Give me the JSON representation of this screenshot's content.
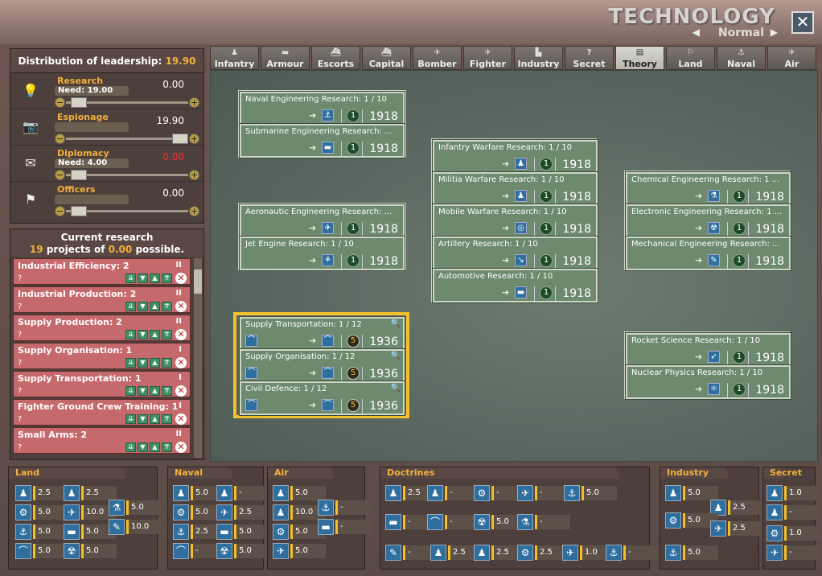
{
  "window": {
    "title": "TECHNOLOGY",
    "mode": "Normal",
    "close": "✕"
  },
  "leadership": {
    "label": "Distribution of leadership:",
    "value": "19.90",
    "rows": [
      {
        "name": "Research",
        "need": "Need: 19.00",
        "value": "0.00",
        "icon": "lightbulb-icon"
      },
      {
        "name": "Espionage",
        "need": "",
        "value": "19.90",
        "icon": "camera-icon"
      },
      {
        "name": "Diplomacy",
        "need": "Need: 4.00",
        "value": "0.00",
        "icon": "envelope-icon"
      },
      {
        "name": "Officers",
        "need": "",
        "value": "0.00",
        "icon": "flag-icon"
      }
    ]
  },
  "current": {
    "title": "Current research",
    "count": "19",
    "mid": "projects of",
    "amt": "0.00",
    "tail": "possible.",
    "items": [
      {
        "name": "Industrial Efficiency: 2",
        "q": "?",
        "pri": "II"
      },
      {
        "name": "Industrial Production: 2",
        "q": "?",
        "pri": "II"
      },
      {
        "name": "Supply Production: 2",
        "q": "?",
        "pri": "II"
      },
      {
        "name": "Supply Organisation: 1",
        "q": "?",
        "pri": "I"
      },
      {
        "name": "Supply Transportation: 1",
        "q": "?",
        "pri": "I"
      },
      {
        "name": "Fighter Ground Crew Training: 1",
        "q": "?",
        "pri": "I"
      },
      {
        "name": "Small Arms: 2",
        "q": "?",
        "pri": "II"
      }
    ]
  },
  "tabs": [
    "Infantry",
    "Armour",
    "Escorts",
    "Capital",
    "Bomber",
    "Fighter",
    "Industry",
    "Secret",
    "Theory",
    "Land",
    "Naval",
    "Air"
  ],
  "active_tab": "Theory",
  "cards": [
    {
      "name": "Naval Engineering Research: 1 / 10",
      "cnt": "1",
      "yr": "1918"
    },
    {
      "name": "Submarine Engineering Research:  ...",
      "cnt": "1",
      "yr": "1918"
    },
    {
      "name": "Aeronautic Engineering Research:  ...",
      "cnt": "1",
      "yr": "1918"
    },
    {
      "name": "Jet Engine Research: 1 / 10",
      "cnt": "1",
      "yr": "1918"
    },
    {
      "name": "Supply Transportation: 1 / 12",
      "cnt": "5",
      "yr": "1936"
    },
    {
      "name": "Supply Organisation: 1 / 12",
      "cnt": "5",
      "yr": "1936"
    },
    {
      "name": "Civil Defence: 1 / 12",
      "cnt": "5",
      "yr": "1936"
    },
    {
      "name": "Infantry Warfare Research: 1 / 10",
      "cnt": "1",
      "yr": "1918"
    },
    {
      "name": "Militia Warfare Research: 1 / 10",
      "cnt": "1",
      "yr": "1918"
    },
    {
      "name": "Mobile Warfare Research: 1 / 10",
      "cnt": "1",
      "yr": "1918"
    },
    {
      "name": "Artillery Research: 1 / 10",
      "cnt": "1",
      "yr": "1918"
    },
    {
      "name": "Automotive Research: 1 / 10",
      "cnt": "1",
      "yr": "1918"
    },
    {
      "name": "Chemical Engineering Research: 1  ...",
      "cnt": "1",
      "yr": "1918"
    },
    {
      "name": "Electronic Engineering Research: 1  ...",
      "cnt": "1",
      "yr": "1918"
    },
    {
      "name": "Mechanical Engineering Research:  ...",
      "cnt": "1",
      "yr": "1918"
    },
    {
      "name": "Rocket Science Research: 1 / 10",
      "cnt": "1",
      "yr": "1918"
    },
    {
      "name": "Nuclear Physics Research: 1 / 10",
      "cnt": "1",
      "yr": "1918"
    }
  ],
  "bottom": {
    "land": {
      "title": "Land",
      "vals": [
        "2.5",
        "2.5",
        "5.0",
        "10.0",
        "5.0",
        "5.0",
        "5.0",
        "5.0",
        "5.0",
        "10.0"
      ]
    },
    "naval": {
      "title": "Naval",
      "vals": [
        "5.0",
        "-",
        "5.0",
        "2.5",
        "2.5",
        "5.0",
        "-",
        "5.0"
      ]
    },
    "air": {
      "title": "Air",
      "vals": [
        "5.0",
        "10.0",
        "5.0",
        "5.0",
        "-",
        "-"
      ]
    },
    "doctrines": {
      "title": "Doctrines",
      "vals": [
        "2.5",
        "-",
        "-",
        "-",
        "5.0",
        "-",
        "-",
        "5.0",
        "-",
        "-",
        "2.5",
        "2.5",
        "2.5",
        "1.0",
        "-"
      ]
    },
    "industry": {
      "title": "Industry",
      "vals": [
        "5.0",
        "2.5",
        "5.0",
        "2.5",
        "5.0"
      ]
    },
    "secret": {
      "title": "Secret",
      "vals": [
        "1.0",
        "-",
        "1.0",
        "-"
      ]
    }
  }
}
